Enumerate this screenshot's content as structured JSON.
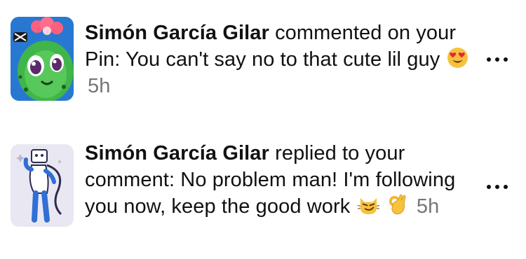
{
  "notifications": [
    {
      "name": "Simón García Gilar",
      "message": "commented on your Pin: You can't say no to that cute lil guy",
      "emojis": [
        "heart-eyes-emoji"
      ],
      "time": "5h",
      "avatar": "cactus-character-avatar",
      "more": "more-options-icon"
    },
    {
      "name": "Simón García Gilar",
      "message": "replied to your comment: No problem man! I'm following you now, keep the good work",
      "emojis": [
        "smirking-cat-emoji",
        "ok-hand-emoji"
      ],
      "time": "5h",
      "avatar": "robot-character-avatar",
      "more": "more-options-icon"
    }
  ],
  "colors": {
    "text": "#111111",
    "timestamp": "#767676",
    "avatar1_bg": "#2d6fd8",
    "avatar2_bg": "#e9e8f2"
  }
}
